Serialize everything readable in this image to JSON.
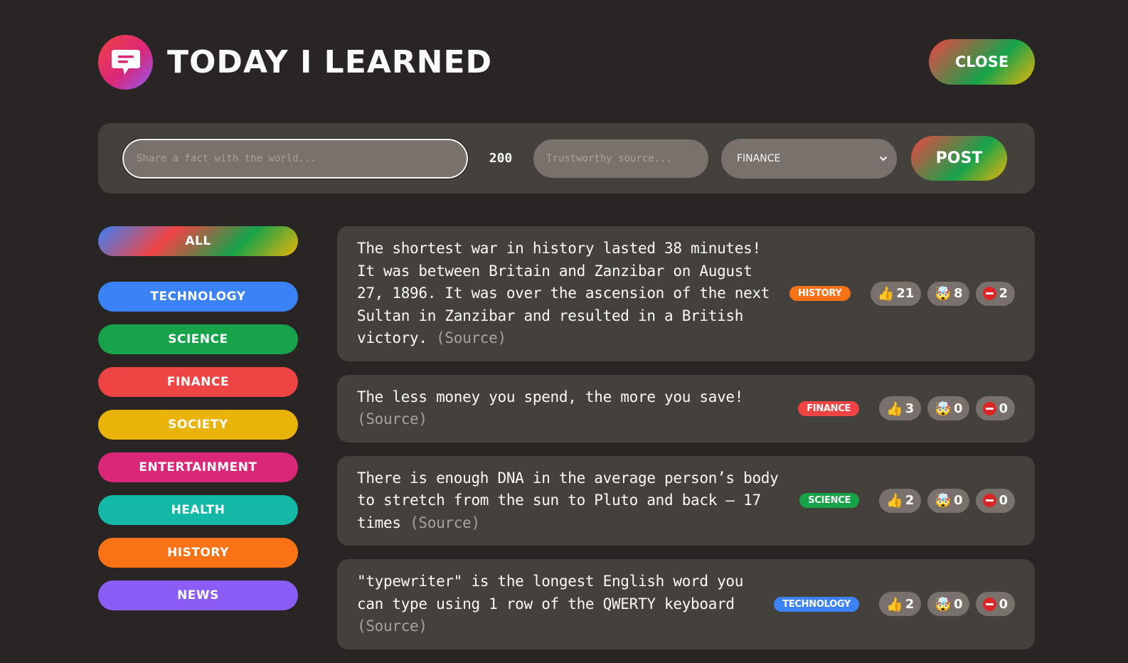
{
  "header": {
    "title": "Today I Learned",
    "close_label": "Close"
  },
  "form": {
    "fact_placeholder": "Share a fact with the world...",
    "char_count": "200",
    "source_placeholder": "Trustworthy source...",
    "selected_category": "FINANCE",
    "post_label": "Post"
  },
  "sidebar": {
    "all_label": "All",
    "categories": [
      {
        "label": "Technology",
        "color": "#3b82f6"
      },
      {
        "label": "Science",
        "color": "#16a34a"
      },
      {
        "label": "Finance",
        "color": "#ef4444"
      },
      {
        "label": "Society",
        "color": "#eab308"
      },
      {
        "label": "Entertainment",
        "color": "#db2777"
      },
      {
        "label": "Health",
        "color": "#14b8a6"
      },
      {
        "label": "History",
        "color": "#f97316"
      },
      {
        "label": "News",
        "color": "#8b5cf6"
      }
    ]
  },
  "facts": [
    {
      "text": "The shortest war in history lasted 38 minutes! It was between Britain and Zanzibar on August 27, 1896. It was over the ascension of the next Sultan in Zanzibar and resulted in a British victory.",
      "source": "(Source)",
      "category": "History",
      "category_color": "#f97316",
      "interesting": "21",
      "mindblowing": "8",
      "false": "2"
    },
    {
      "text": "The less money you spend, the more you save!",
      "source": "(Source)",
      "category": "Finance",
      "category_color": "#ef4444",
      "interesting": "3",
      "mindblowing": "0",
      "false": "0"
    },
    {
      "text": "There is enough DNA in the average person’s body to stretch from the sun to Pluto and back — 17 times",
      "source": "(Source)",
      "category": "Science",
      "category_color": "#16a34a",
      "interesting": "2",
      "mindblowing": "0",
      "false": "0"
    },
    {
      "text": "\"typewriter\" is the longest English word you can type using 1 row of the QWERTY keyboard",
      "source": "(Source)",
      "category": "Technology",
      "category_color": "#3b82f6",
      "interesting": "2",
      "mindblowing": "0",
      "false": "0"
    }
  ],
  "icons": {
    "logo": "chat-bubble-icon",
    "interesting": "thumbs-up-icon",
    "mindblowing": "exploding-head-icon",
    "false": "no-entry-icon",
    "select": "chevron-down-icon"
  }
}
